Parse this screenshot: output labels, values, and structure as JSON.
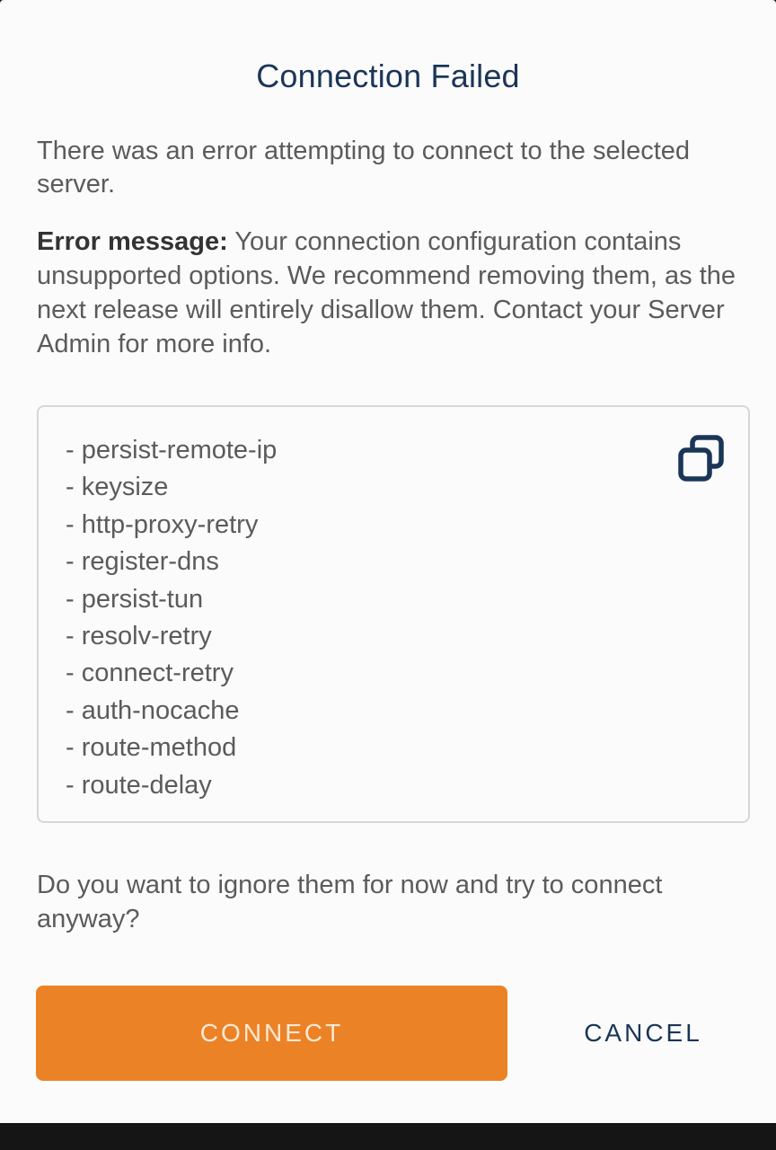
{
  "dialog": {
    "title": "Connection Failed",
    "intro": "There was an error attempting to connect to the selected server.",
    "error_label": "Error message:",
    "error_text": " Your connection configuration contains unsupported options. We recommend removing them, as the next release will entirely disallow them. Contact your Server Admin for more info.",
    "options": [
      "- persist-remote-ip",
      "- keysize",
      "- http-proxy-retry",
      "- register-dns",
      "- persist-tun",
      "- resolv-retry",
      "- connect-retry",
      "- auth-nocache",
      "- route-method",
      "- route-delay"
    ],
    "copy_icon": "copy-icon",
    "question": "Do you want to ignore them for now and try to connect anyway?",
    "connect_label": "CONNECT",
    "cancel_label": "CANCEL"
  },
  "colors": {
    "accent": "#ec8226",
    "title": "#1b3557",
    "body_text": "#5b5b5b",
    "background": "#fbfbfb"
  }
}
